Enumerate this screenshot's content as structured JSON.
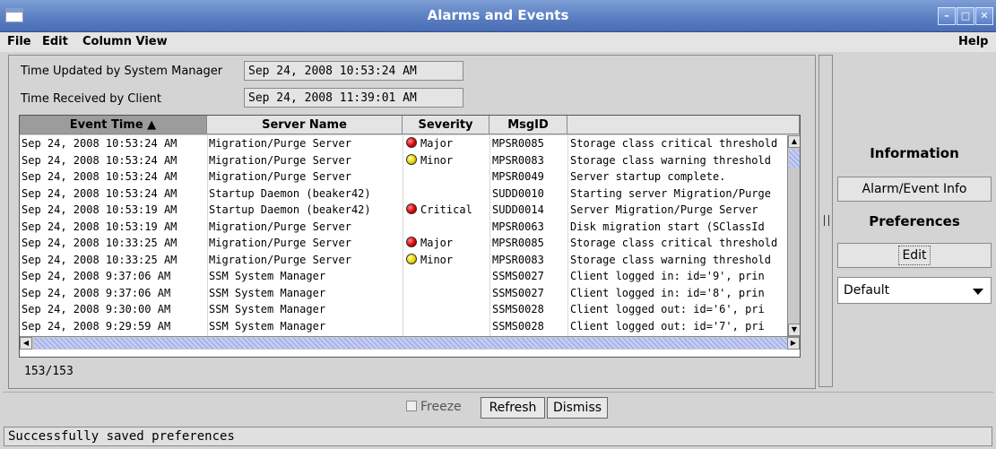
{
  "window": {
    "title": "Alarms and Events",
    "buttons": [
      "minimize-icon",
      "maximize-icon",
      "close-icon"
    ]
  },
  "menu": {
    "items": [
      "File",
      "Edit",
      "Column View"
    ],
    "help": "Help"
  },
  "info": {
    "updated_label": "Time Updated by System Manager",
    "updated_value": "Sep 24, 2008 10:53:24 AM",
    "received_label": "Time Received by Client",
    "received_value": "Sep 24, 2008 11:39:01 AM"
  },
  "table": {
    "columns": [
      "Event Time ▲",
      "Server Name",
      "Severity",
      "MsgID",
      ""
    ],
    "rows": [
      {
        "time": "Sep 24, 2008 10:53:24 AM",
        "server": "Migration/Purge Server",
        "severity": "Major",
        "msgid": "MPSR0085",
        "message": "Storage class critical threshold"
      },
      {
        "time": "Sep 24, 2008 10:53:24 AM",
        "server": "Migration/Purge Server",
        "severity": "Minor",
        "msgid": "MPSR0083",
        "message": "Storage class warning threshold"
      },
      {
        "time": "Sep 24, 2008 10:53:24 AM",
        "server": "Migration/Purge Server",
        "severity": "",
        "msgid": "MPSR0049",
        "message": "Server startup complete."
      },
      {
        "time": "Sep 24, 2008 10:53:24 AM",
        "server": "Startup Daemon (beaker42)",
        "severity": "",
        "msgid": "SUDD0010",
        "message": "Starting server Migration/Purge"
      },
      {
        "time": "Sep 24, 2008 10:53:19 AM",
        "server": "Startup Daemon (beaker42)",
        "severity": "Critical",
        "msgid": "SUDD0014",
        "message": "Server Migration/Purge Server"
      },
      {
        "time": "Sep 24, 2008 10:53:19 AM",
        "server": "Migration/Purge Server",
        "severity": "",
        "msgid": "MPSR0063",
        "message": "Disk migration start (SClassId"
      },
      {
        "time": "Sep 24, 2008 10:33:25 AM",
        "server": "Migration/Purge Server",
        "severity": "Major",
        "msgid": "MPSR0085",
        "message": "Storage class critical threshold"
      },
      {
        "time": "Sep 24, 2008 10:33:25 AM",
        "server": "Migration/Purge Server",
        "severity": "Minor",
        "msgid": "MPSR0083",
        "message": "Storage class warning threshold"
      },
      {
        "time": "Sep 24, 2008 9:37:06 AM",
        "server": "SSM System Manager",
        "severity": "",
        "msgid": "SSMS0027",
        "message": "Client logged in: id='9', prin"
      },
      {
        "time": "Sep 24, 2008 9:37:06 AM",
        "server": "SSM System Manager",
        "severity": "",
        "msgid": "SSMS0027",
        "message": "Client logged in: id='8', prin"
      },
      {
        "time": "Sep 24, 2008 9:30:00 AM",
        "server": "SSM System Manager",
        "severity": "",
        "msgid": "SSMS0028",
        "message": "Client logged out: id='6', pri"
      },
      {
        "time": "Sep 24, 2008 9:29:59 AM",
        "server": "SSM System Manager",
        "severity": "",
        "msgid": "SSMS0028",
        "message": "Client logged out: id='7', pri"
      }
    ],
    "count": "153/153"
  },
  "side": {
    "information_heading": "Information",
    "alarm_info_button": "Alarm/Event Info",
    "preferences_heading": "Preferences",
    "edit_button": "Edit",
    "preference_select": "Default"
  },
  "actions": {
    "freeze": "Freeze",
    "refresh": "Refresh",
    "dismiss": "Dismiss"
  },
  "status": {
    "message": "Successfully saved preferences"
  },
  "colors": {
    "title_bar": "#5b7fc2",
    "major": "#dd0000",
    "minor": "#e8d800"
  }
}
